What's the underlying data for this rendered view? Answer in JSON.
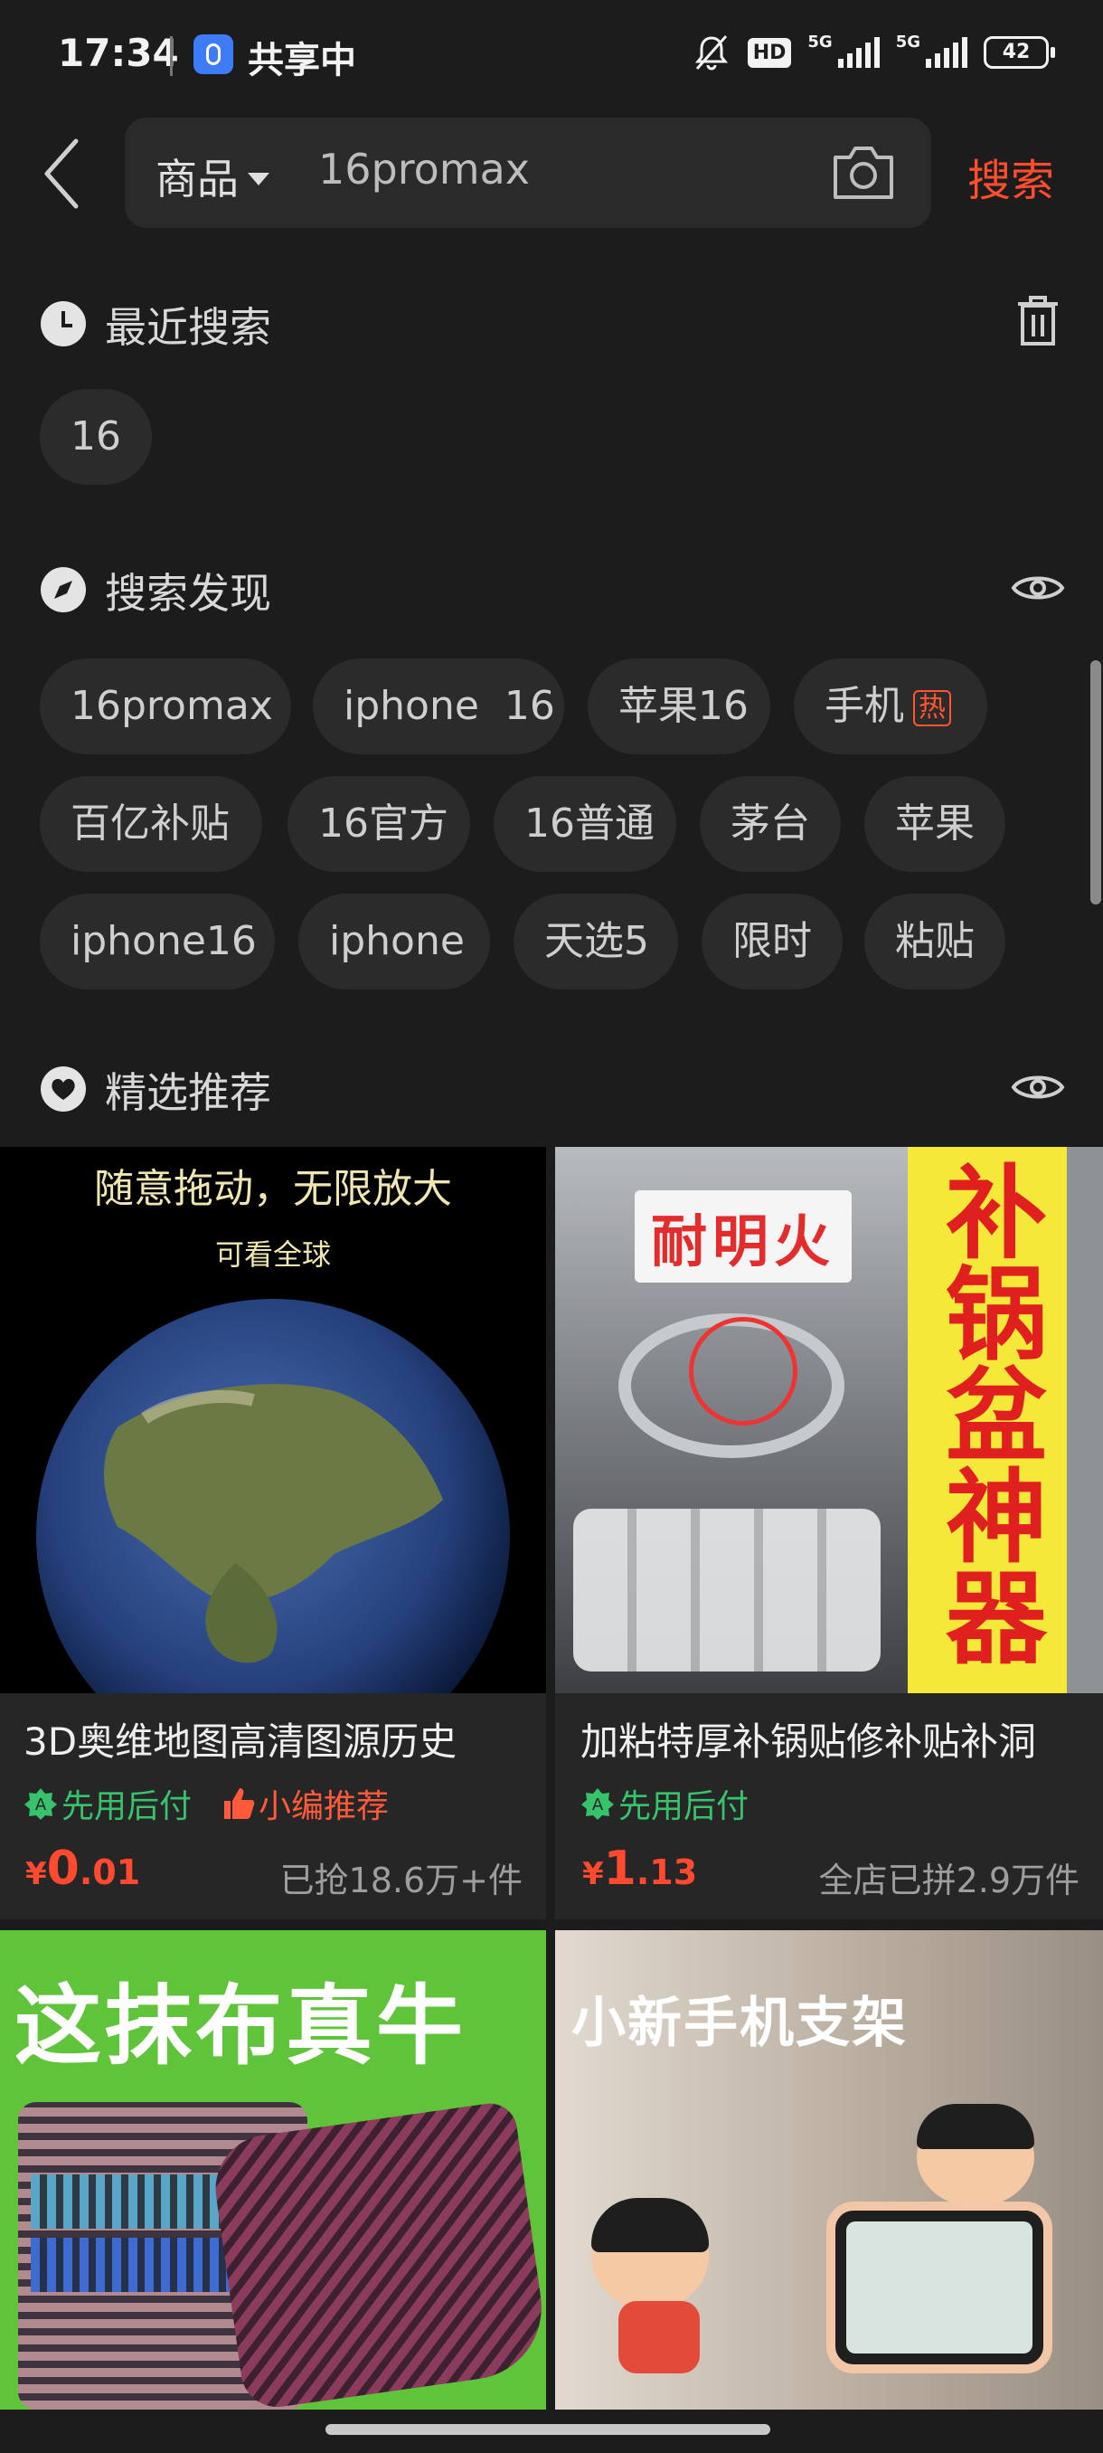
{
  "status_bar": {
    "time": "17:34",
    "sharing_label": "共享中",
    "hd_label": "HD",
    "net1": "5G",
    "net2": "5G",
    "battery": "42"
  },
  "header": {
    "scope_label": "商品",
    "query": "16promax",
    "search_button": "搜索"
  },
  "recent": {
    "title": "最近搜索",
    "items": [
      "16"
    ]
  },
  "discover": {
    "title": "搜索发现",
    "hot_badge": "热",
    "chips": [
      "16promax",
      "iphone  16",
      "苹果16",
      "手机",
      "百亿补贴",
      "16官方",
      "16普通",
      "茅台",
      "苹果",
      "iphone16",
      "iphone",
      "天选5",
      "限时",
      "粘贴"
    ]
  },
  "recommend": {
    "title": "精选推荐",
    "products": [
      {
        "img_top": "随意拖动，无限放大",
        "img_sub": "可看全球",
        "title": "3D奥维地图高清图源历史",
        "tag1": "先用后付",
        "tag2": "小编推荐",
        "currency": "¥",
        "price_int": "0",
        "price_dec": ".01",
        "sold": "已抢18.6万+件"
      },
      {
        "img_banner": "耐明火",
        "img_side": "补锅盆神器",
        "title": "加粘特厚补锅贴修补贴补洞",
        "tag1": "先用后付",
        "currency": "¥",
        "price_int": "1",
        "price_dec": ".13",
        "sold": "全店已拼2.9万件"
      },
      {
        "img_text": "这抹布真牛"
      },
      {
        "img_text": "小新手机支架"
      }
    ]
  }
}
